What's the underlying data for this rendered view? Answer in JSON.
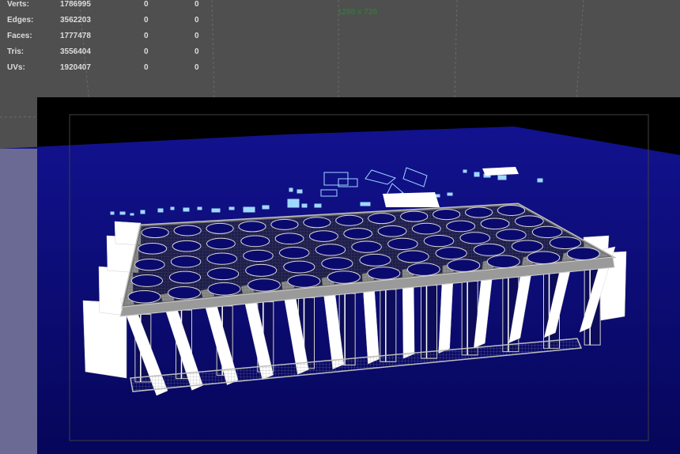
{
  "hud": {
    "rows": [
      {
        "label": "Verts:",
        "values": [
          "1786995",
          "0",
          "0"
        ]
      },
      {
        "label": "Edges:",
        "values": [
          "3562203",
          "0",
          "0"
        ]
      },
      {
        "label": "Faces:",
        "values": [
          "1777478",
          "0",
          "0"
        ]
      },
      {
        "label": "Tris:",
        "values": [
          "3556404",
          "0",
          "0"
        ]
      },
      {
        "label": "UVs:",
        "values": [
          "1920407",
          "0",
          "0"
        ]
      }
    ]
  },
  "viewport": {
    "resolution_label": "1280 x 720",
    "colors": {
      "background": "#4f4f4f",
      "gate_mask": "#000000",
      "ground": "#0b0b7e",
      "mesh_wire": "#bdbdbd",
      "panel": "#ffffff",
      "hole": "#0a0a6e",
      "highlight": "#9fd8ff"
    },
    "tray": {
      "columns": 12,
      "rows": 5
    }
  }
}
